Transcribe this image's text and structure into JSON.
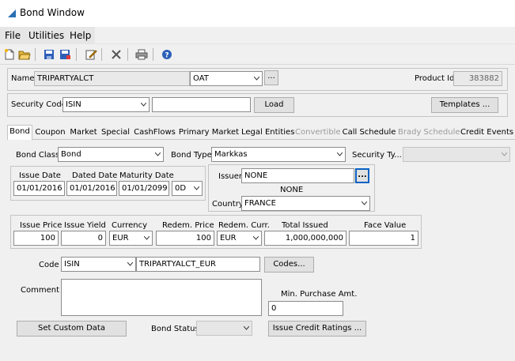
{
  "window": {
    "title": "Bond Window"
  },
  "menu": [
    "File",
    "Utilities",
    "Help"
  ],
  "toolbar": [
    "new-icon",
    "open-icon",
    "save-icon",
    "save-as-icon",
    "edit-icon",
    "delete-icon",
    "print-icon",
    "help-icon"
  ],
  "header": {
    "name_label": "Name",
    "name_value": "TRIPARTYALCT",
    "name_type": "OAT",
    "ellipsis": "...",
    "product_id_label": "Product Id",
    "product_id_value": "383882"
  },
  "security": {
    "label": "Security Code",
    "code_type": "ISIN",
    "code_value": "",
    "load_label": "Load",
    "templates_label": "Templates ..."
  },
  "tabs": [
    {
      "label": "Bond",
      "state": "active"
    },
    {
      "label": "Coupon",
      "state": "normal"
    },
    {
      "label": "Market",
      "state": "normal"
    },
    {
      "label": "Special",
      "state": "normal"
    },
    {
      "label": "CashFlows",
      "state": "normal"
    },
    {
      "label": "Primary Market",
      "state": "normal"
    },
    {
      "label": "Legal Entities",
      "state": "normal"
    },
    {
      "label": "Convertible",
      "state": "disabled"
    },
    {
      "label": "Call Schedule",
      "state": "normal"
    },
    {
      "label": "Brady Schedule",
      "state": "disabled"
    },
    {
      "label": "Credit Events",
      "state": "normal"
    }
  ],
  "bond": {
    "class_label": "Bond Class",
    "class_value": "Bond",
    "type_label": "Bond Type",
    "type_value": "Markkas",
    "sectype_label": "Security Ty...",
    "sectype_value": "",
    "issue_date_label": "Issue Date",
    "issue_date": "01/01/2016",
    "dated_date_label": "Dated Date",
    "dated_date": "01/01/2016",
    "maturity_label": "Maturity Date",
    "maturity_date": "01/01/2099",
    "tenor": "0D",
    "issuer_label": "Issuer",
    "issuer_value": "NONE",
    "issuer_button": "...",
    "issuer_desc": "NONE",
    "country_label": "Country",
    "country_value": "FRANCE",
    "issue_price_label": "Issue Price",
    "issue_price": "100",
    "issue_yield_label": "Issue Yield",
    "issue_yield": "0",
    "currency_label": "Currency",
    "currency": "EUR",
    "redem_price_label": "Redem. Price",
    "redem_price": "100",
    "redem_curr_label": "Redem. Curr.",
    "redem_curr": "EUR",
    "total_issued_label": "Total Issued",
    "total_issued": "1,000,000,000",
    "face_value_label": "Face Value",
    "face_value": "1",
    "code_label": "Code",
    "code_type": "ISIN",
    "code_value": "TRIPARTYALCT_EUR",
    "codes_button": "Codes...",
    "comment_label": "Comment",
    "comment_value": "",
    "min_purchase_label": "Min. Purchase Amt.",
    "min_purchase": "0",
    "custom_data_button": "Set Custom Data",
    "status_label": "Bond Status",
    "status_value": "",
    "ratings_button": "Issue Credit Ratings ..."
  }
}
